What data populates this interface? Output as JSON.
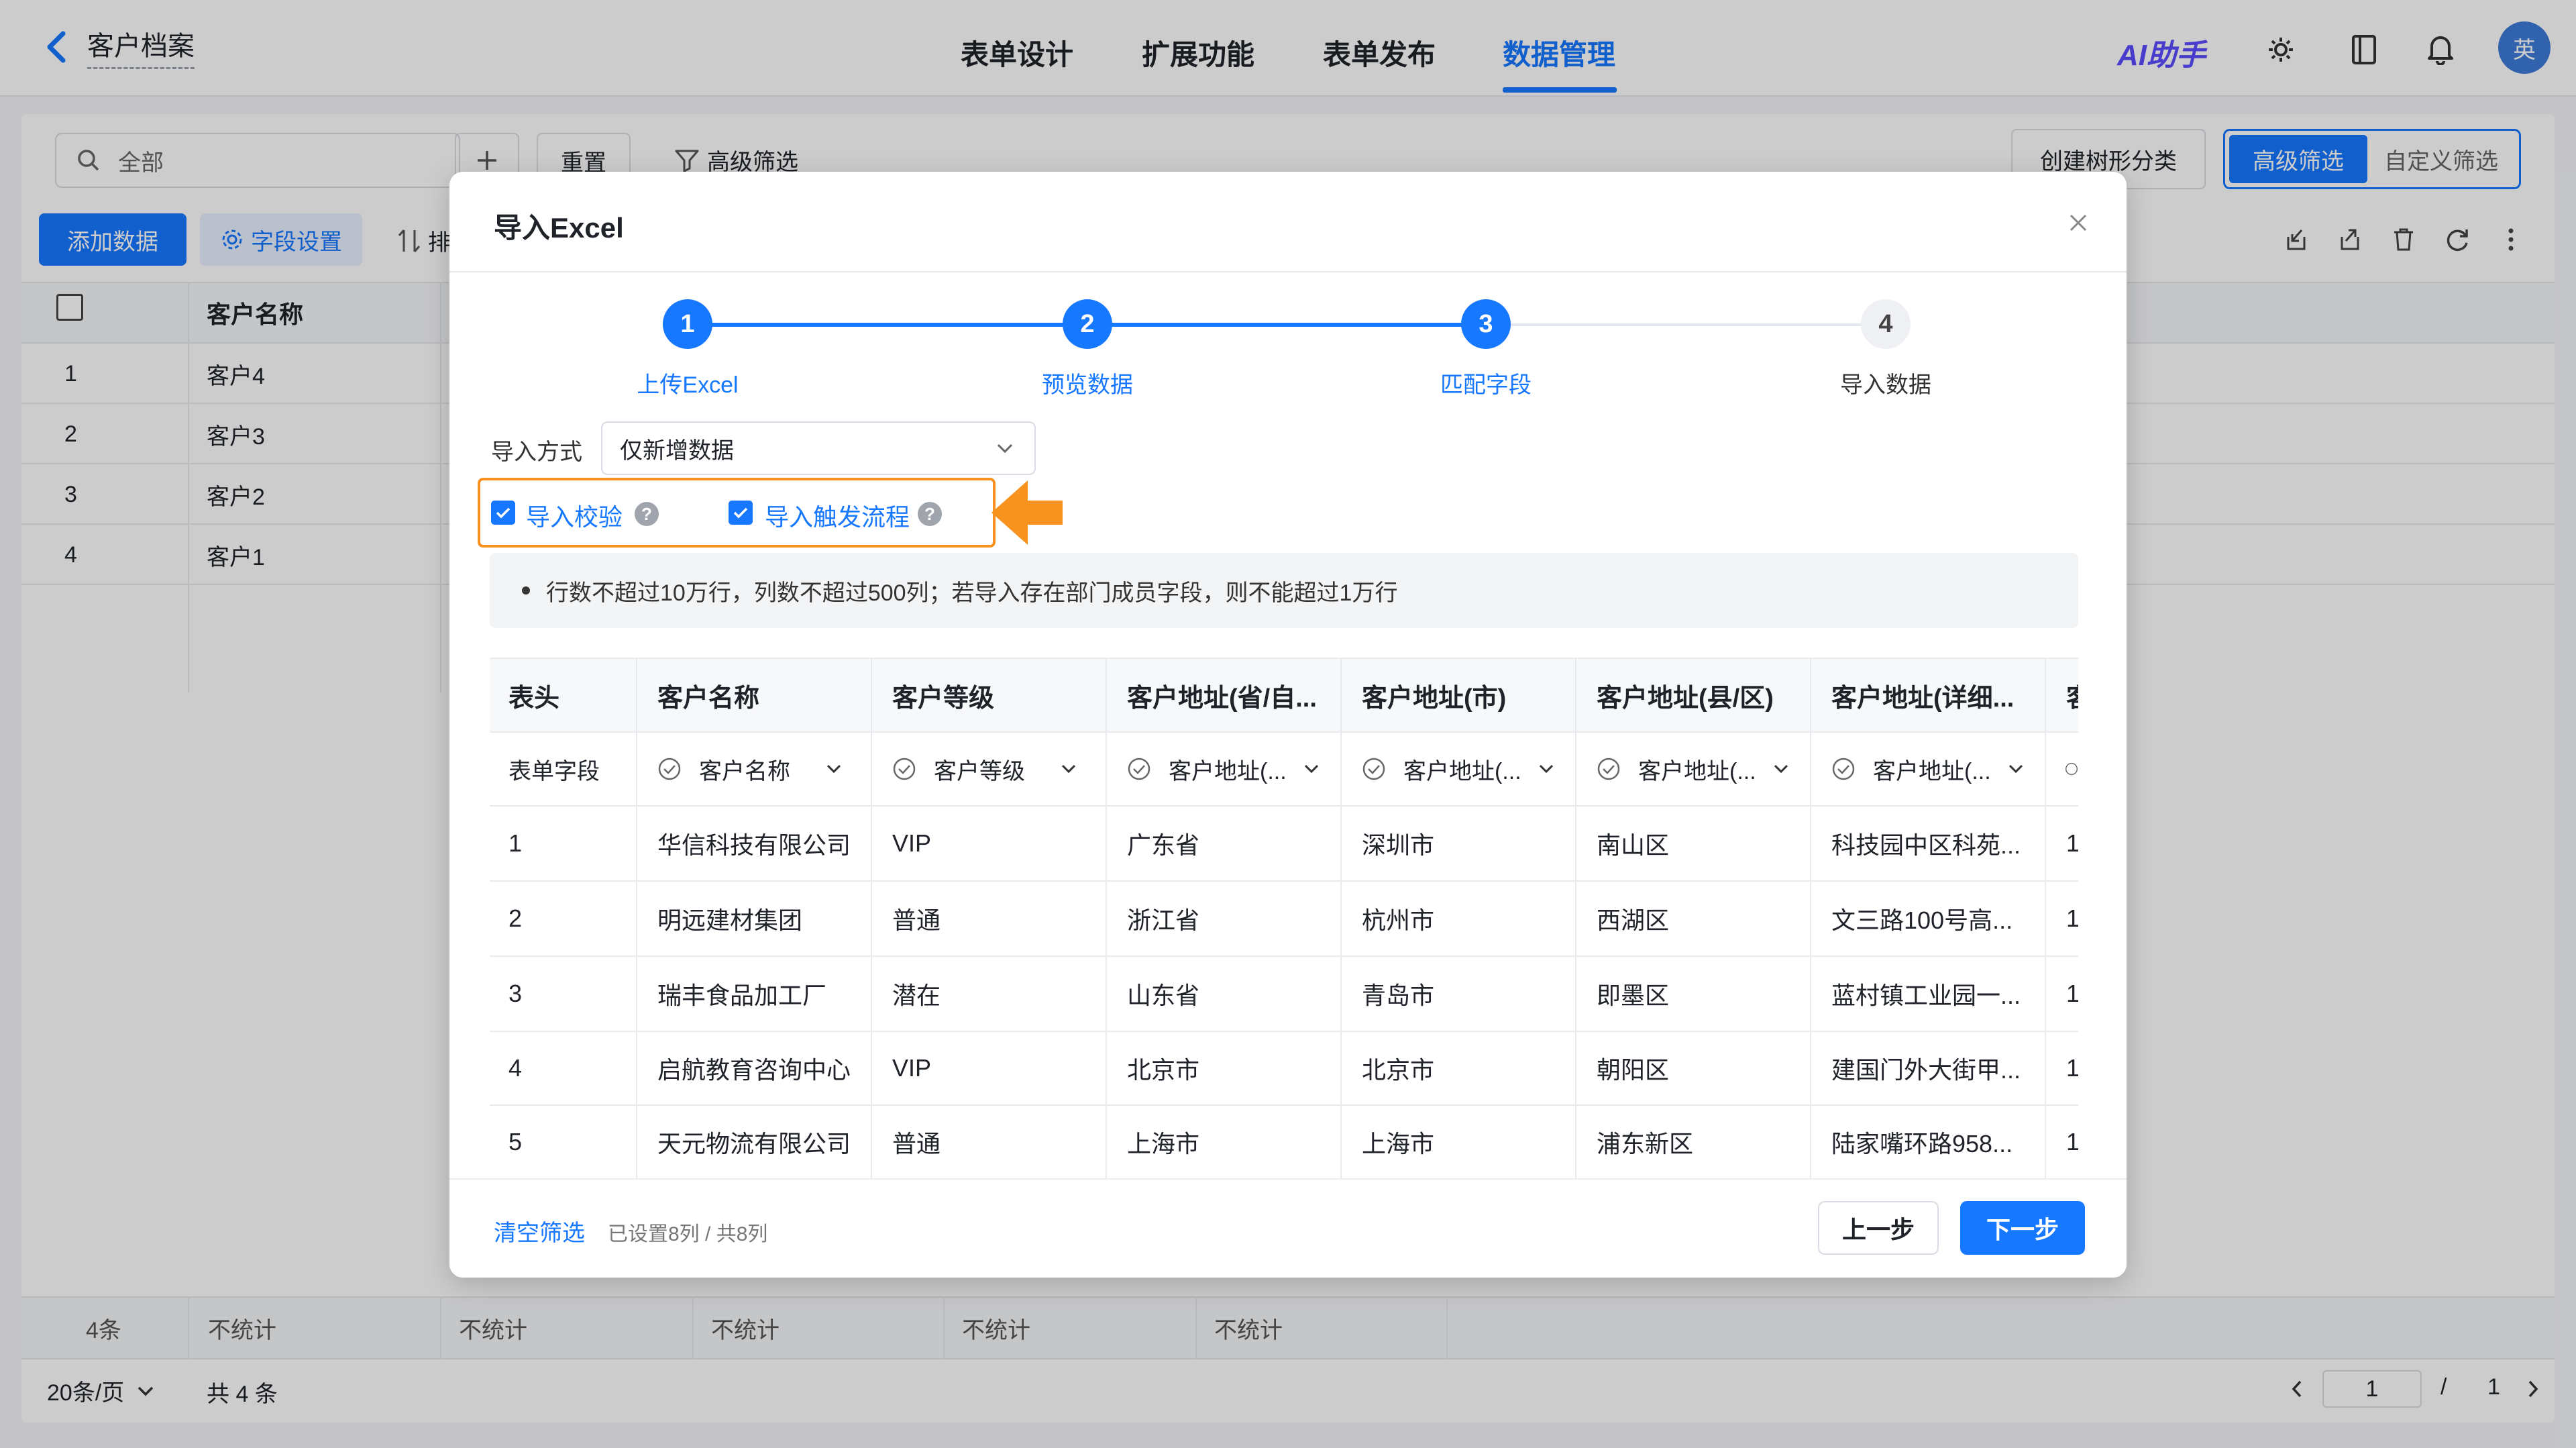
{
  "header": {
    "back_title": "客户档案",
    "tabs": [
      {
        "label": "表单设计"
      },
      {
        "label": "扩展功能"
      },
      {
        "label": "表单发布"
      },
      {
        "label": "数据管理"
      }
    ],
    "active_tab_index": 3,
    "ai_label": "AI助手",
    "avatar_text": "英",
    "accent_color": "#1677ff",
    "icons": [
      "settings-switch-icon",
      "book-icon",
      "bell-icon"
    ]
  },
  "toolbar": {
    "search_placeholder": "全部",
    "add_icon": "plus-icon",
    "reset_label": "重置",
    "filter_label": "高级筛选",
    "tree_label": "创建树形分类",
    "adv_filter_label": "高级筛选",
    "custom_filter_label": "自定义筛选",
    "add_data_label": "添加数据",
    "field_settings_label": "字段设置",
    "sort_label": "排"
  },
  "grid": {
    "col_name": "客户名称",
    "rows": [
      {
        "index": "1",
        "name": "客户4"
      },
      {
        "index": "2",
        "name": "客户3"
      },
      {
        "index": "3",
        "name": "客户2"
      },
      {
        "index": "4",
        "name": "客户1"
      }
    ],
    "summary_count": "4条",
    "summary_values": [
      "不统计",
      "不统计",
      "不统计",
      "不统计",
      "不统计"
    ],
    "page_size": "20条/页",
    "total_label": "共 4 条",
    "page_current": "1",
    "page_sep": "/",
    "page_total": "1"
  },
  "modal": {
    "title": "导入Excel",
    "steps": [
      {
        "num": "1",
        "label": "上传Excel"
      },
      {
        "num": "2",
        "label": "预览数据"
      },
      {
        "num": "3",
        "label": "匹配字段"
      },
      {
        "num": "4",
        "label": "导入数据"
      }
    ],
    "active_step": 3,
    "import_mode_label": "导入方式",
    "import_mode_value": "仅新增数据",
    "check_validate_label": "导入校验",
    "check_trigger_label": "导入触发流程",
    "notice": "行数不超过10万行，列数不超过500列；若导入存在部门成员字段，则不能超过1万行",
    "table": {
      "headers": [
        "表头",
        "客户名称",
        "客户等级",
        "客户地址(省/自...",
        "客户地址(市)",
        "客户地址(县/区)",
        "客户地址(详细...",
        "客"
      ],
      "field_row_label": "表单字段",
      "field_mapping": [
        "客户名称",
        "客户等级",
        "客户地址(...",
        "客户地址(...",
        "客户地址(...",
        "客户地址(...",
        ""
      ],
      "rows": [
        [
          "1",
          "华信科技有限公司",
          "VIP",
          "广东省",
          "深圳市",
          "南山区",
          "科技园中区科苑...",
          "1"
        ],
        [
          "2",
          "明远建材集团",
          "普通",
          "浙江省",
          "杭州市",
          "西湖区",
          "文三路100号高...",
          "1"
        ],
        [
          "3",
          "瑞丰食品加工厂",
          "潜在",
          "山东省",
          "青岛市",
          "即墨区",
          "蓝村镇工业园一...",
          "1"
        ],
        [
          "4",
          "启航教育咨询中心",
          "VIP",
          "北京市",
          "北京市",
          "朝阳区",
          "建国门外大街甲...",
          "1"
        ],
        [
          "5",
          "天元物流有限公司",
          "普通",
          "上海市",
          "上海市",
          "浦东新区",
          "陆家嘴环路958...",
          "1"
        ]
      ]
    },
    "footer": {
      "clear_filter": "清空筛选",
      "status": "已设置8列 / 共8列",
      "prev": "上一步",
      "next": "下一步"
    },
    "highlight_color": "#f7931e"
  }
}
